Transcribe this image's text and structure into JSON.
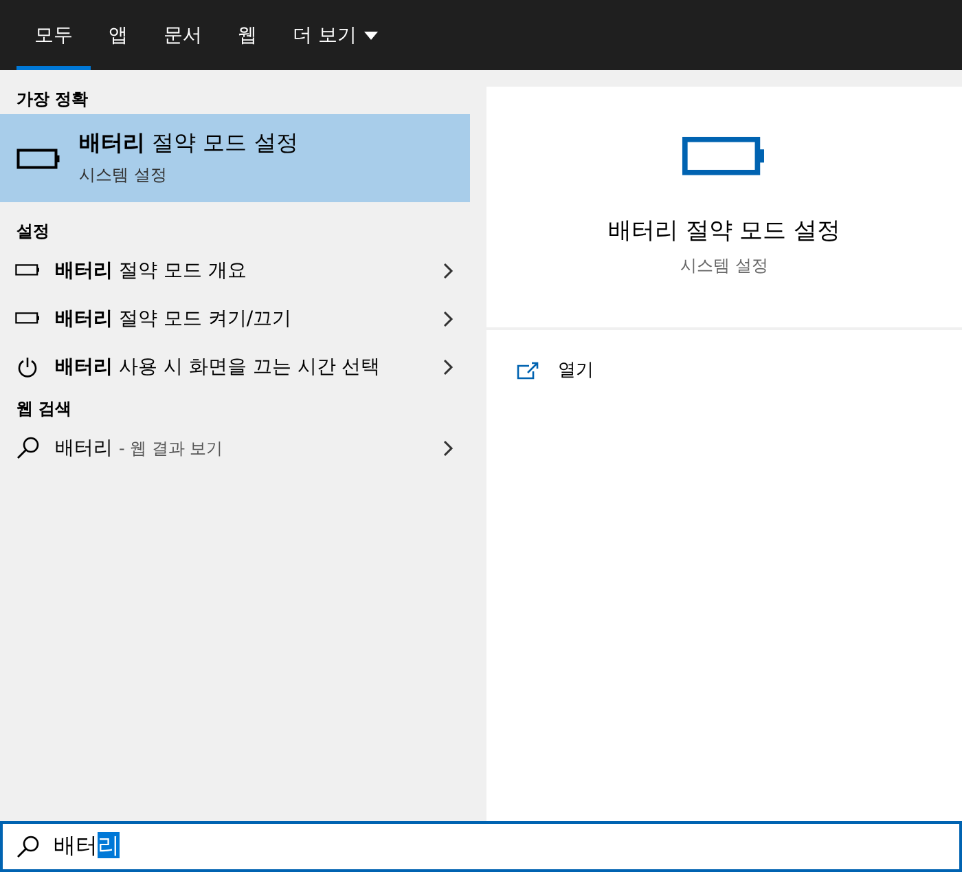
{
  "tabs": [
    {
      "kind": "tab",
      "label": "모두",
      "selected": true
    },
    {
      "kind": "tab",
      "label": "앱",
      "selected": false
    },
    {
      "kind": "tab",
      "label": "문서",
      "selected": false
    },
    {
      "kind": "tab",
      "label": "웹",
      "selected": false
    },
    {
      "kind": "menu",
      "label": "더 보기",
      "selected": false
    }
  ],
  "sections": [
    {
      "heading": "가장 정확",
      "items": [
        {
          "kind": "best",
          "title": "**배터리** 절약 모드 설정",
          "subtitle": "시스템 설정",
          "selected": true
        }
      ]
    },
    {
      "heading": "설정",
      "items": [
        {
          "kind": "battery",
          "title": "**배터리** 절약 모드 개요",
          "selected": false
        },
        {
          "kind": "battery",
          "title": "**배터리** 절약 모드 켜기/끄기",
          "selected": false
        },
        {
          "kind": "power",
          "title": "**배터리** 사용 시 화면을 끄는 시간 선택",
          "selected": false
        }
      ]
    },
    {
      "heading": "웹 검색",
      "items": [
        {
          "kind": "web",
          "title": "배터리",
          "suffix": "- 웹 결과 보기",
          "selected": false
        }
      ]
    }
  ],
  "preview": {
    "title": "배터리 절약 모드 설정",
    "subtitle": "시스템 설정",
    "actions": [
      {
        "label": "열기"
      }
    ]
  },
  "search": {
    "text": "배터",
    "selected_text": "리"
  }
}
